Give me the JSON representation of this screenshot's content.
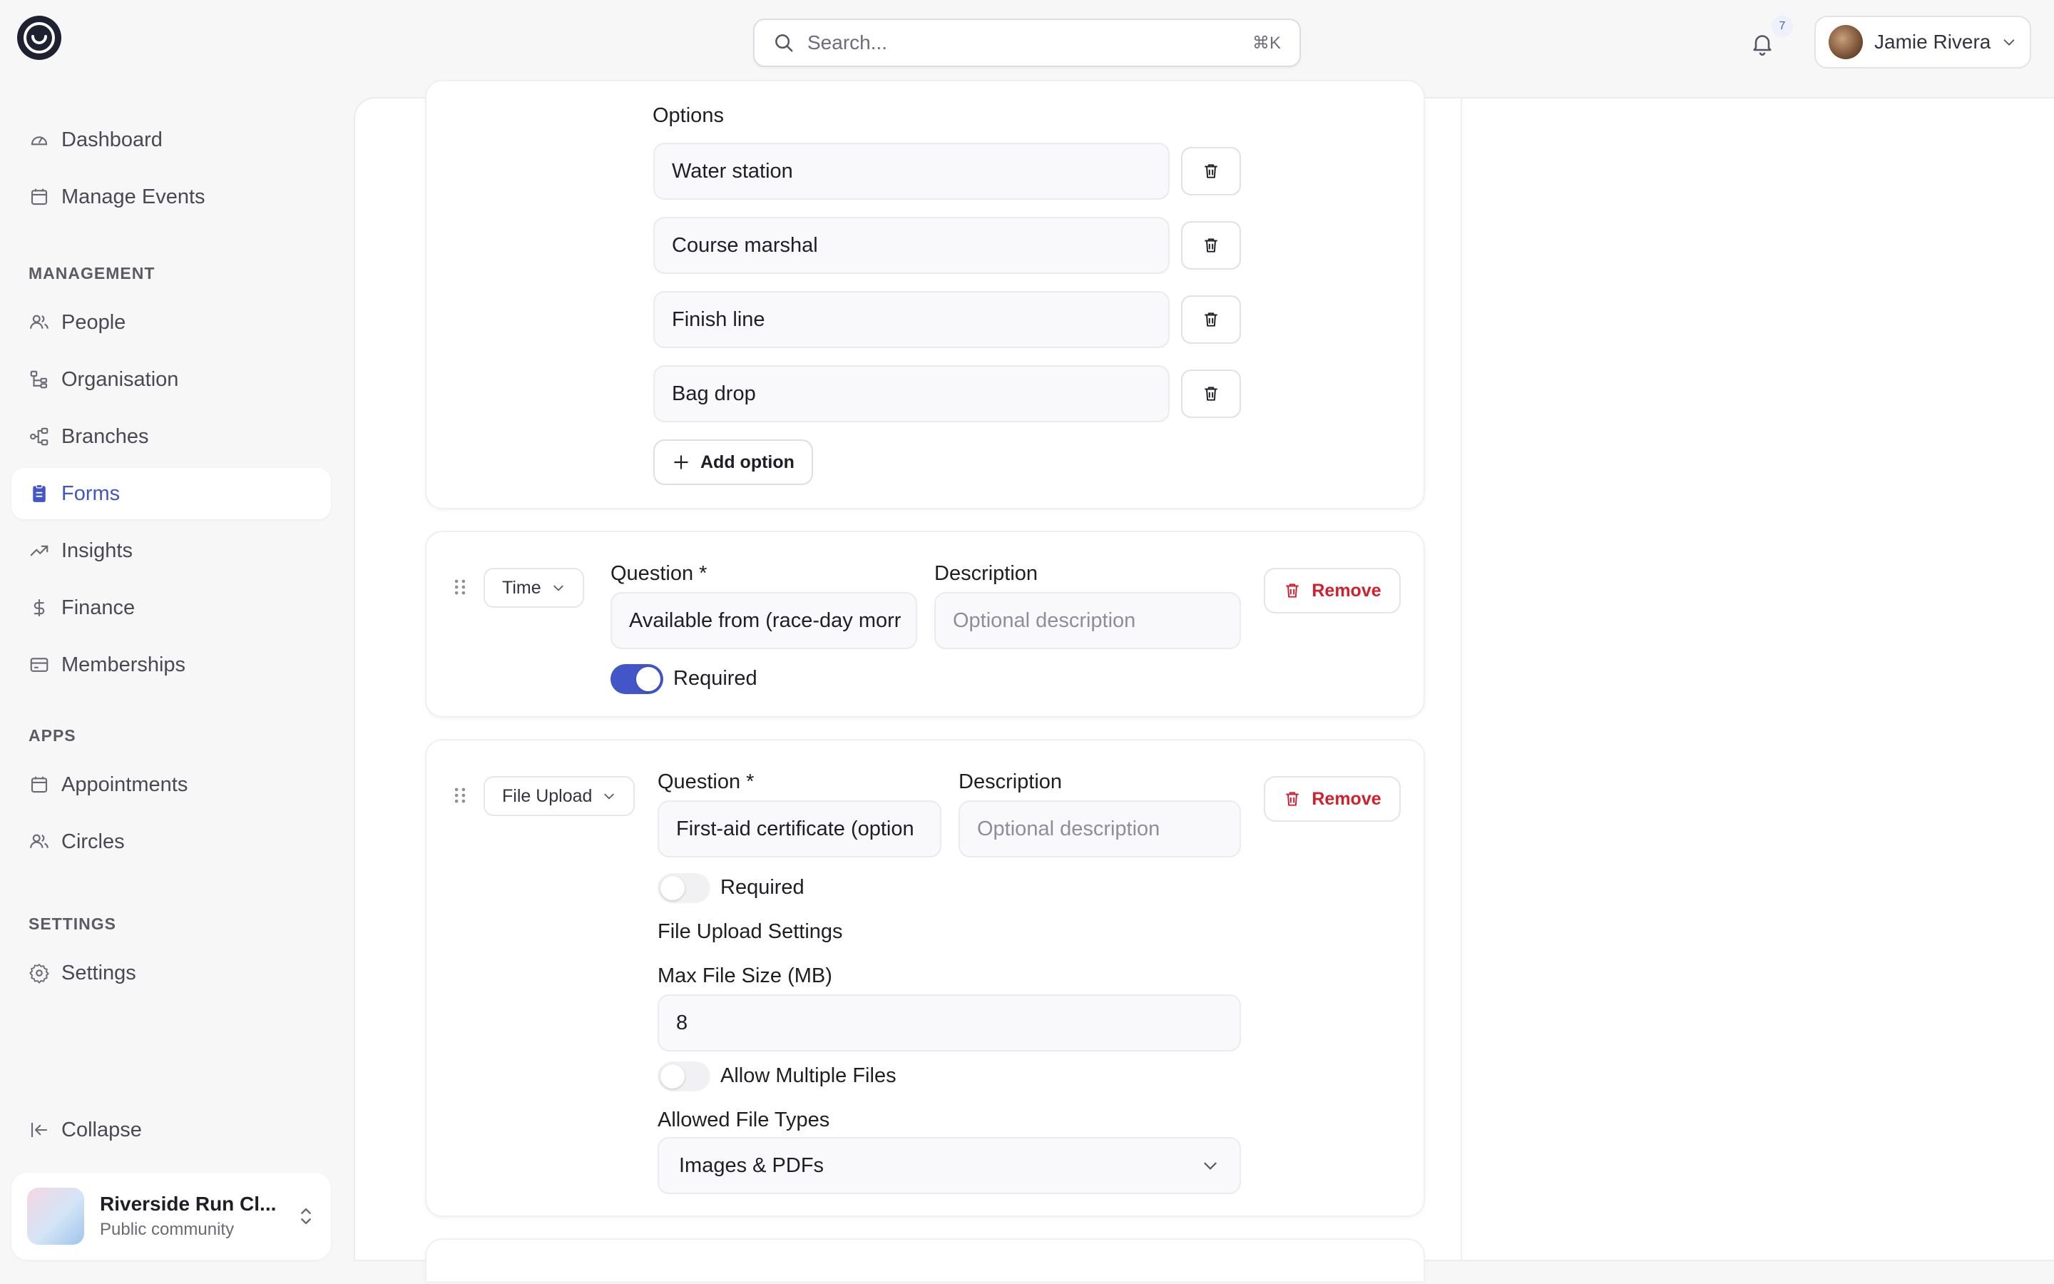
{
  "header": {
    "search_placeholder": "Search...",
    "search_shortcut": "⌘K",
    "notification_count": "7",
    "user_name": "Jamie Rivera"
  },
  "sidebar": {
    "dashboard": "Dashboard",
    "manage_events": "Manage Events",
    "management_heading": "MANAGEMENT",
    "people": "People",
    "organisation": "Organisation",
    "branches": "Branches",
    "forms": "Forms",
    "insights": "Insights",
    "finance": "Finance",
    "memberships": "Memberships",
    "apps_heading": "APPS",
    "appointments": "Appointments",
    "circles": "Circles",
    "settings_heading": "SETTINGS",
    "settings": "Settings",
    "collapse": "Collapse",
    "community_name": "Riverside Run Cl...",
    "community_sub": "Public community"
  },
  "options_card": {
    "label": "Options",
    "options": [
      "Water station",
      "Course marshal",
      "Finish line",
      "Bag drop"
    ],
    "add_option": "Add option"
  },
  "time_card": {
    "type": "Time",
    "question_label": "Question *",
    "question_value": "Available from (race-day morr",
    "description_label": "Description",
    "description_placeholder": "Optional description",
    "required_label": "Required",
    "required": true,
    "remove": "Remove"
  },
  "upload_card": {
    "type": "File Upload",
    "question_label": "Question *",
    "question_value": "First-aid certificate (option",
    "description_label": "Description",
    "description_placeholder": "Optional description",
    "required_label": "Required",
    "required": false,
    "remove": "Remove",
    "settings_heading": "File Upload Settings",
    "max_size_label": "Max File Size (MB)",
    "max_size_value": "8",
    "allow_multiple_label": "Allow Multiple Files",
    "allow_multiple": false,
    "allowed_types_label": "Allowed File Types",
    "allowed_types_value": "Images & PDFs"
  }
}
